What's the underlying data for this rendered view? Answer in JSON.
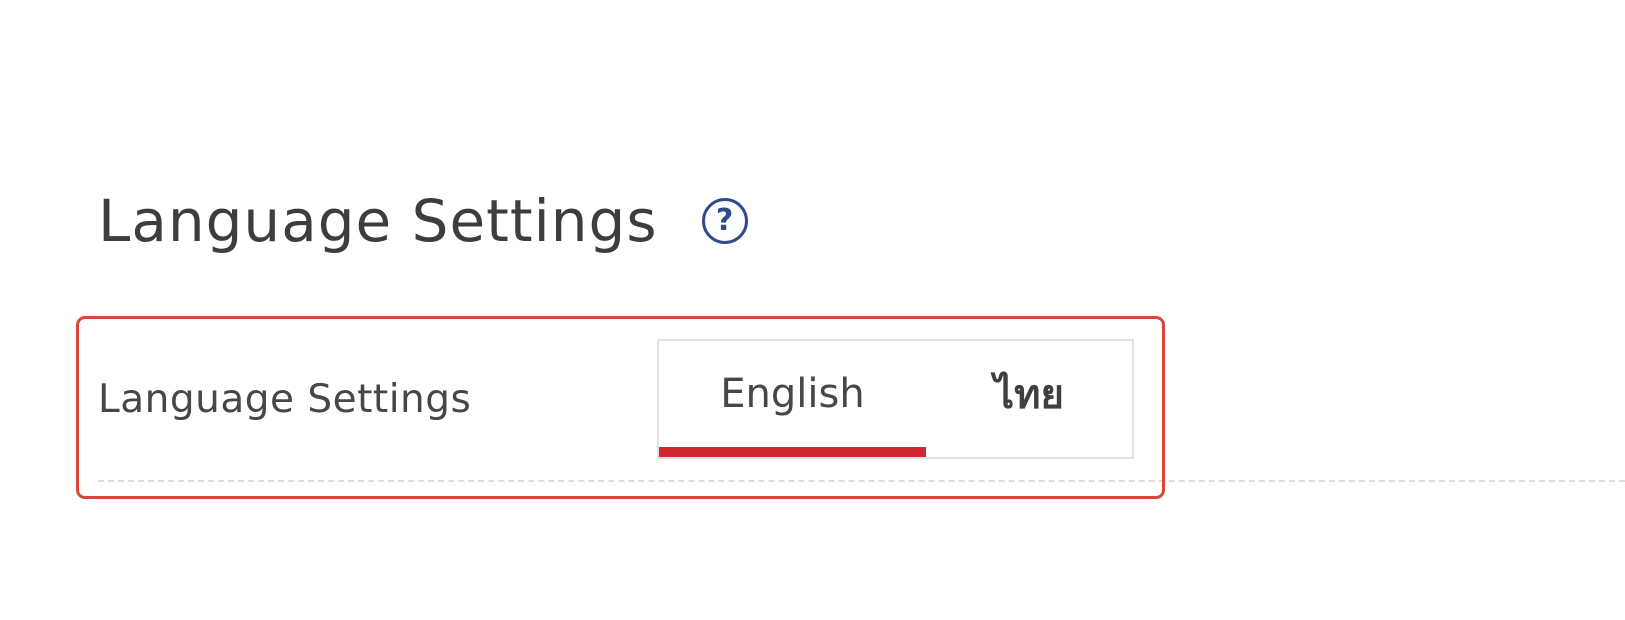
{
  "header": {
    "title": "Language Settings",
    "help_icon": "question-circle-icon"
  },
  "setting": {
    "label": "Language Settings",
    "options": [
      {
        "label": "English",
        "selected": true
      },
      {
        "label": "ไทย",
        "selected": false
      }
    ]
  },
  "colors": {
    "accent": "#d4262e",
    "highlight_border": "#d9473a",
    "help_icon": "#2f4b8e"
  }
}
